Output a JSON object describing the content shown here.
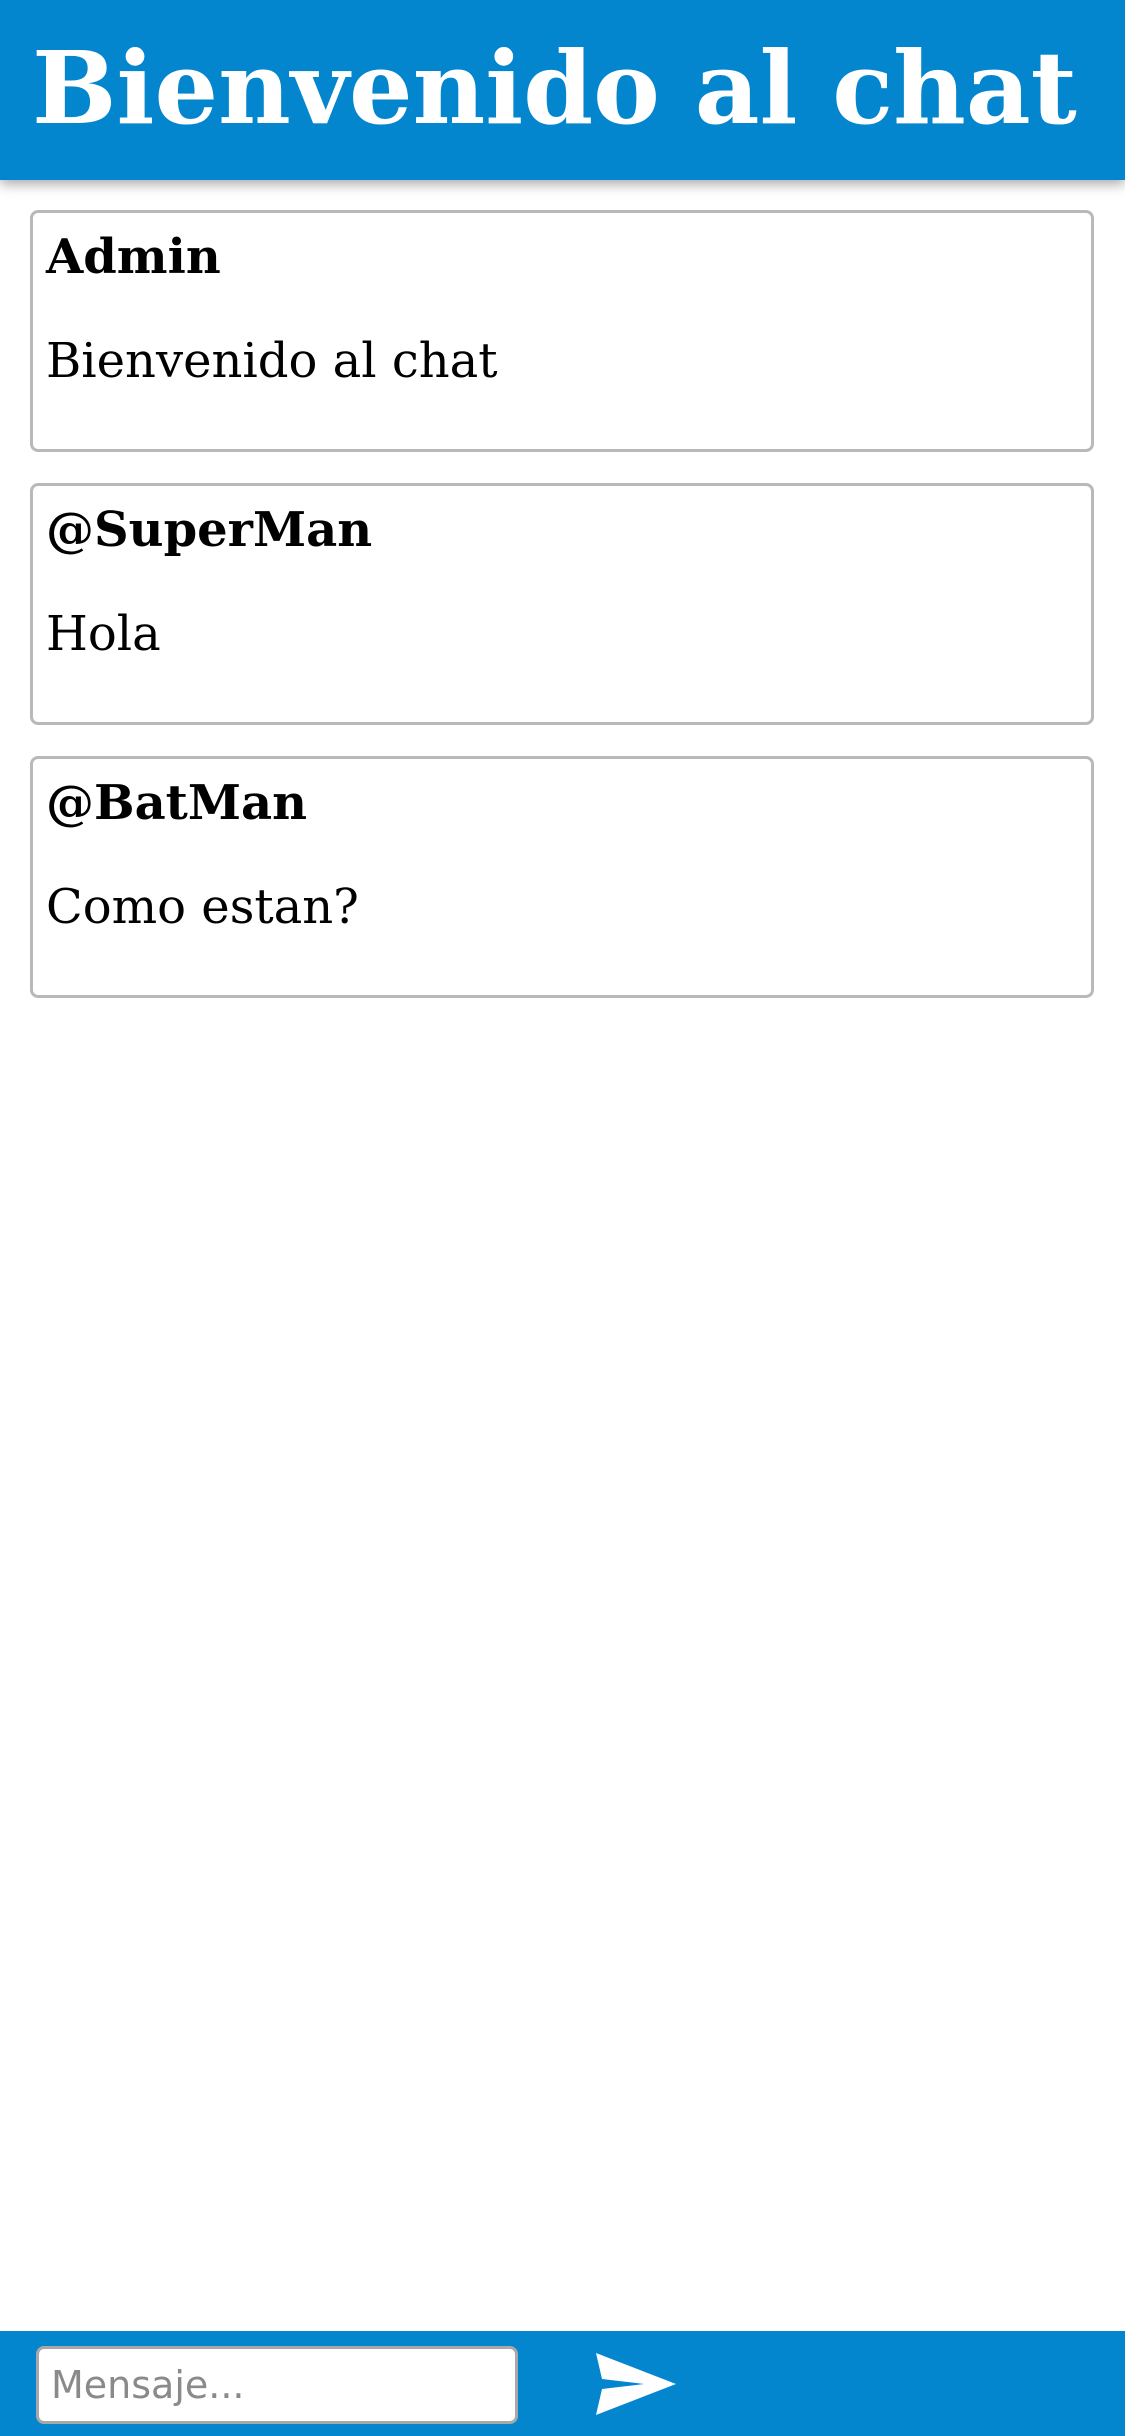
{
  "header": {
    "title": "Bienvenido al chat"
  },
  "messages": [
    {
      "author": "Admin",
      "text": "Bienvenido al chat"
    },
    {
      "author": "@SuperMan",
      "text": "Hola"
    },
    {
      "author": "@BatMan",
      "text": "Como estan?"
    }
  ],
  "composer": {
    "placeholder": "Mensaje...",
    "value": "",
    "send_icon": "send-icon"
  },
  "colors": {
    "brand": "#0486cf",
    "card_border": "#b9b9b9",
    "text": "#000000"
  }
}
